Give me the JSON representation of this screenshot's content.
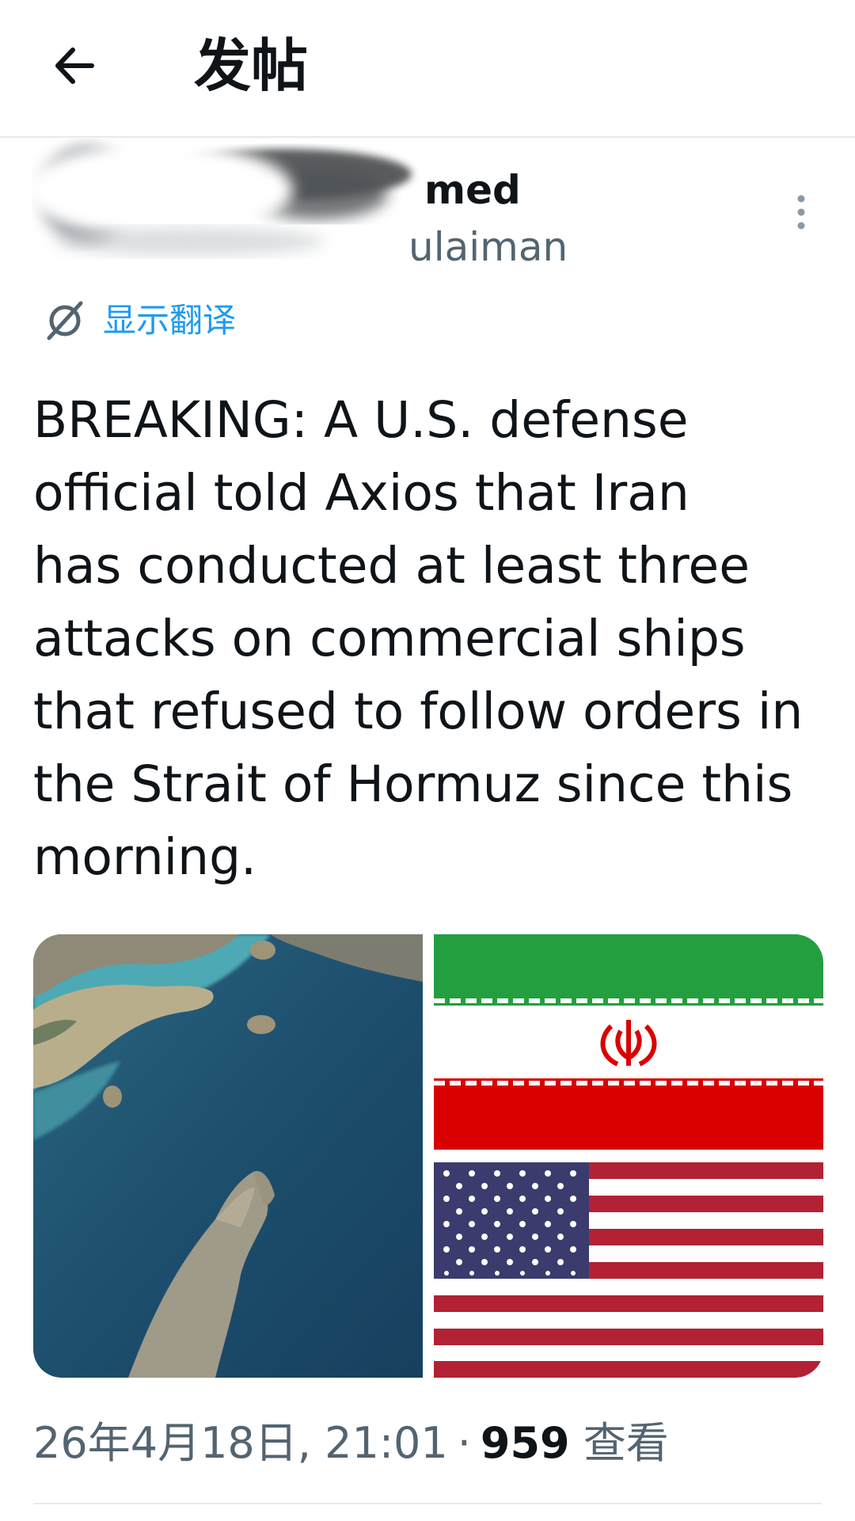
{
  "header": {
    "title": "发帖",
    "back_icon": "arrow-left-icon"
  },
  "author": {
    "display_name_visible": "med",
    "handle_visible": "ulaiman",
    "more_icon": "vertical-ellipsis-icon"
  },
  "translate": {
    "label": "显示翻译",
    "icon": "translate-icon",
    "color": "#1d9bf0"
  },
  "tweet": {
    "text": "BREAKING: A U.S. defense\nofficial told Axios that Iran\nhas conducted at least three\nattacks on commercial ships\nthat refused to follow orders in\nthe Strait of Hormuz since this\nmorning."
  },
  "media": {
    "images": [
      {
        "name": "strait-of-hormuz-satellite-image",
        "description_icon": "satellite-map"
      },
      {
        "name": "iran-flag-image",
        "colors": [
          "#239f40",
          "#ffffff",
          "#da0000"
        ]
      },
      {
        "name": "us-flag-image",
        "colors": [
          "#b22234",
          "#ffffff",
          "#3c3b6e"
        ]
      }
    ]
  },
  "meta": {
    "timestamp": "26年4月18日, 21:01",
    "separator": "·",
    "views_count": "959",
    "views_label": "查看"
  }
}
